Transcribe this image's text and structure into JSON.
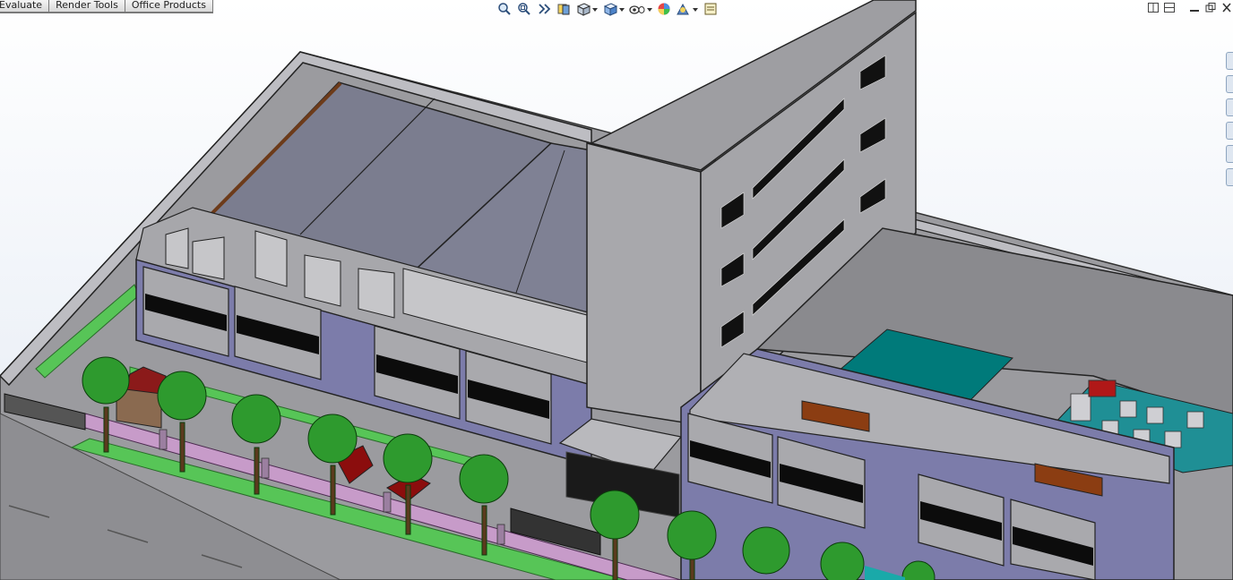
{
  "tabs": [
    "Evaluate",
    "Render Tools",
    "Office Products"
  ],
  "hud_icons": [
    "zoom-to-fit-icon",
    "zoom-to-area-icon",
    "previous-view-icon",
    "section-view-icon",
    "view-orientation-icon",
    "display-style-icon",
    "hide-show-items-icon",
    "edit-appearance-icon",
    "apply-scene-icon",
    "view-settings-icon"
  ],
  "window_controls": [
    "tile-horizontal-icon",
    "tile-vertical-icon",
    "minimize-icon",
    "restore-icon",
    "close-icon"
  ],
  "signage_text": "",
  "colors": {
    "viewport_top": "#ffffff",
    "wall_purple": "#7c7caa",
    "roof": "#7b7d8f",
    "pool": "#007a7a",
    "grass": "#57c557",
    "window": "#0c0c0c"
  }
}
